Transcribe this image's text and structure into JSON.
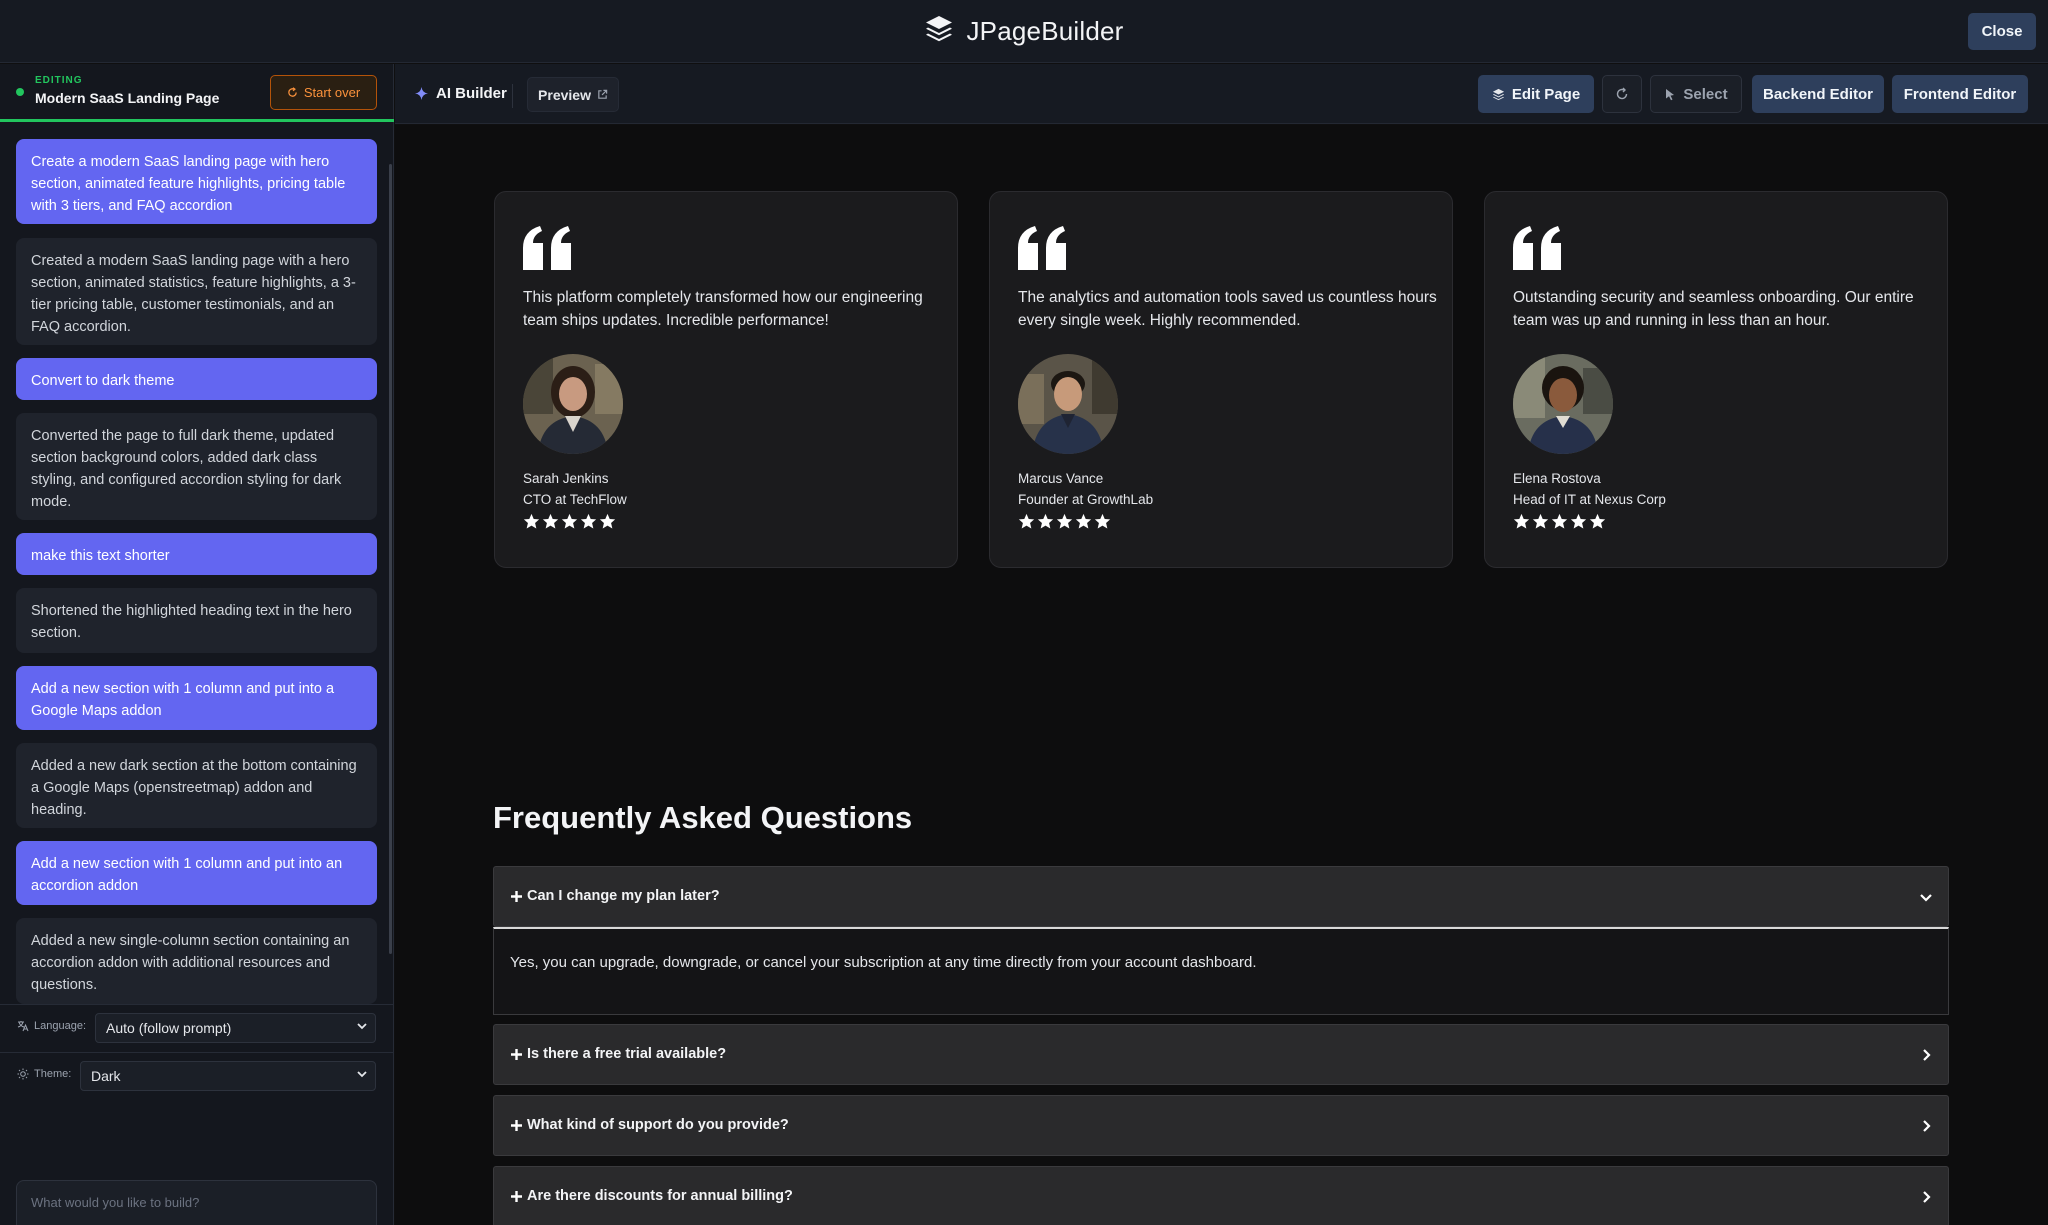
{
  "app": {
    "name": "JPageBuilder",
    "close_label": "Close"
  },
  "sidebar": {
    "status_label": "EDITING",
    "project_name": "Modern SaaS Landing Page",
    "start_over_label": "Start over",
    "messages": [
      {
        "role": "user",
        "text": "Create a modern SaaS landing page with hero section, animated feature highlights, pricing table with 3 tiers, and FAQ accordion"
      },
      {
        "role": "ai",
        "text": "Created a modern SaaS landing page with a hero section, animated statistics, feature highlights, a 3-tier pricing table, customer testimonials, and an FAQ accordion."
      },
      {
        "role": "user",
        "text": "Convert to dark theme"
      },
      {
        "role": "ai",
        "text": "Converted the page to full dark theme, updated section background colors, added dark class styling, and configured accordion styling for dark mode."
      },
      {
        "role": "user",
        "text": "make this text shorter"
      },
      {
        "role": "ai",
        "text": "Shortened the highlighted heading text in the hero section."
      },
      {
        "role": "user",
        "text": "Add a new section with 1 column and put into a Google Maps addon"
      },
      {
        "role": "ai",
        "text": "Added a new dark section at the bottom containing a Google Maps (openstreetmap) addon and heading."
      },
      {
        "role": "user",
        "text": "Add a new section with 1 column and put into an accordion addon"
      },
      {
        "role": "ai",
        "text": "Added a new single-column section containing an accordion addon with additional resources and questions."
      }
    ],
    "language": {
      "label": "Language:",
      "value": "Auto (follow prompt)"
    },
    "theme": {
      "label": "Theme:",
      "value": "Dark"
    },
    "prompt": {
      "placeholder": "What would you like to build?"
    }
  },
  "toolbar": {
    "ai_builder_label": "AI Builder",
    "preview_label": "Preview",
    "edit_page_label": "Edit Page",
    "select_label": "Select",
    "backend_editor_label": "Backend Editor",
    "frontend_editor_label": "Frontend Editor"
  },
  "testimonials": [
    {
      "quote": "This platform completely transformed how our engineering team ships updates. Incredible performance!",
      "name": "Sarah Jenkins",
      "role": "CTO at TechFlow",
      "rating": 5
    },
    {
      "quote": "The analytics and automation tools saved us countless hours every single week. Highly recommended.",
      "name": "Marcus Vance",
      "role": "Founder at GrowthLab",
      "rating": 5
    },
    {
      "quote": "Outstanding security and seamless onboarding. Our entire team was up and running in less than an hour.",
      "name": "Elena Rostova",
      "role": "Head of IT at Nexus Corp",
      "rating": 5
    }
  ],
  "faq": {
    "title": "Frequently Asked Questions",
    "items": [
      {
        "question": "Can I change my plan later?",
        "answer": "Yes, you can upgrade, downgrade, or cancel your subscription at any time directly from your account dashboard.",
        "open": true
      },
      {
        "question": "Is there a free trial available?",
        "open": false
      },
      {
        "question": "What kind of support do you provide?",
        "open": false
      },
      {
        "question": "Are there discounts for annual billing?",
        "open": false
      }
    ]
  },
  "colors": {
    "accent": "#6366f1",
    "success": "#22c55e",
    "warning": "#fb923c",
    "toolbar_button": "#2e3f5c"
  }
}
